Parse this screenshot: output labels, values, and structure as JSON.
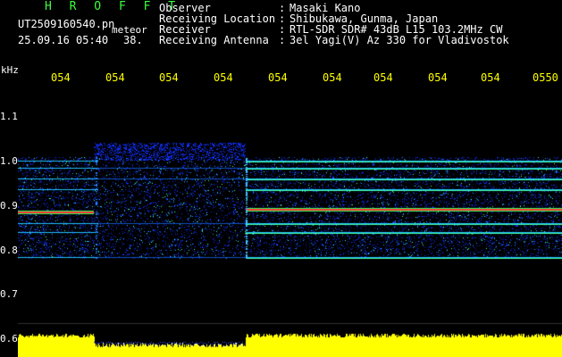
{
  "header": {
    "brand": "H R O F F T",
    "filename": "UT2509160540.pn",
    "meteor_label": "meteor",
    "datetime": "25.09.16 05:40",
    "count": "38."
  },
  "info": [
    {
      "key": "Observer",
      "value": "Masaki Kano"
    },
    {
      "key": "Receiving Location",
      "value": "Shibukawa, Gunma, Japan"
    },
    {
      "key": "Receiver",
      "value": "RTL-SDR SDR# 43dB L15 103.2MHz CW"
    },
    {
      "key": "Receiving Antenna",
      "value": "3el Yagi(V) Az 330 for Vladivostok"
    }
  ],
  "axis": {
    "unit": "kHz",
    "x_ticks": [
      "054",
      "054",
      "054",
      "054",
      "054",
      "054",
      "054",
      "054",
      "054",
      "0550"
    ],
    "y_ticks": [
      "1.1",
      "1.0",
      "0.9",
      "0.8",
      "0.7",
      "0.6"
    ]
  },
  "colors": {
    "background": "#000000",
    "text_yellow": "#ffff00",
    "brand_green": "#3cff3c",
    "noise_blue": "#1030ff",
    "signal_red": "#ff3030",
    "amplitude_yellow": "#ffff00"
  }
}
